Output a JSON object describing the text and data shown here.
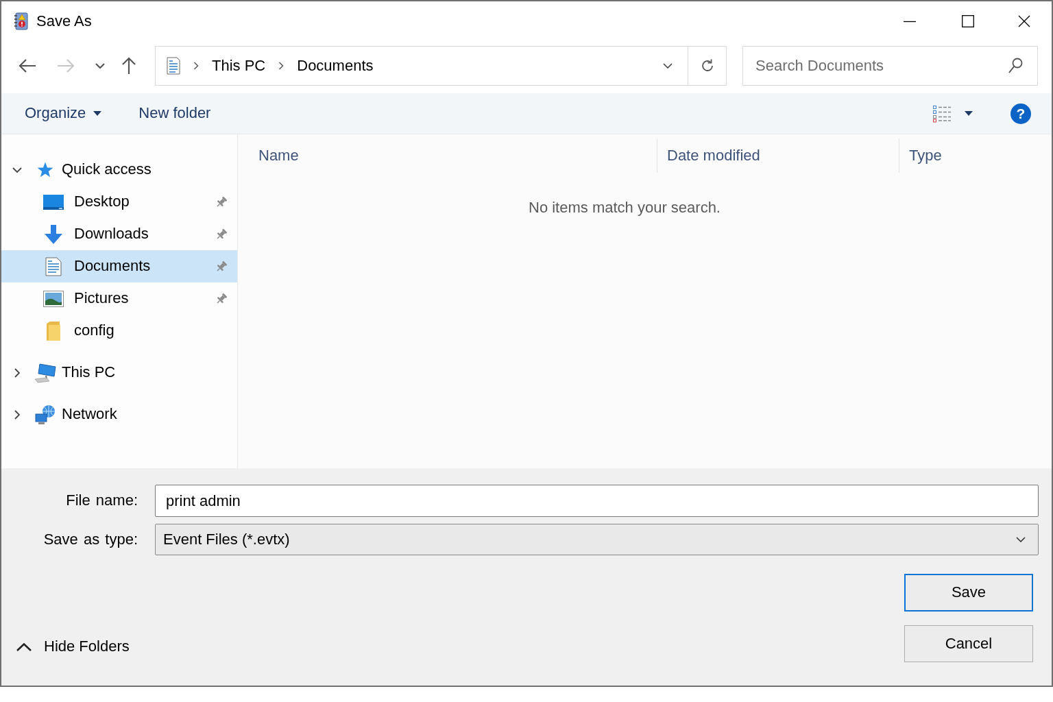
{
  "window": {
    "title": "Save As"
  },
  "navigation": {
    "buttons": [
      {
        "kind": "back",
        "disabled": false
      },
      {
        "kind": "forward",
        "disabled": true
      },
      {
        "kind": "recent",
        "disabled": false
      },
      {
        "kind": "up",
        "disabled": false
      }
    ]
  },
  "address_bar": {
    "breadcrumbs": [
      "This PC",
      "Documents"
    ]
  },
  "search": {
    "placeholder": "Search Documents"
  },
  "toolbar": {
    "organize": "Organize",
    "new_folder": "New folder",
    "help": "?"
  },
  "sidebar": {
    "items": [
      {
        "label": "Quick access",
        "kind": "quick-access",
        "expanded": true,
        "selected": false,
        "children": [
          {
            "label": "Desktop",
            "kind": "desktop",
            "pinned": true,
            "selected": false
          },
          {
            "label": "Downloads",
            "kind": "downloads",
            "pinned": true,
            "selected": false
          },
          {
            "label": "Documents",
            "kind": "documents",
            "pinned": true,
            "selected": true
          },
          {
            "label": "Pictures",
            "kind": "pictures",
            "pinned": true,
            "selected": false
          },
          {
            "label": "config",
            "kind": "folder",
            "pinned": false,
            "selected": false
          }
        ]
      },
      {
        "label": "This PC",
        "kind": "pc",
        "expanded": false,
        "selected": false
      },
      {
        "label": "Network",
        "kind": "network",
        "expanded": false,
        "selected": false
      }
    ]
  },
  "file_list": {
    "columns": [
      "Name",
      "Date modified",
      "Type"
    ],
    "empty_message": "No items match your search."
  },
  "file_name": {
    "label": "File name:",
    "value": "print admin"
  },
  "save_as_type": {
    "label": "Save as type:",
    "value": "Event Files (*.evtx)"
  },
  "buttons": [
    {
      "label": "Save",
      "default": true
    },
    {
      "label": "Cancel",
      "default": false
    }
  ],
  "hide_folders": "Hide Folders"
}
